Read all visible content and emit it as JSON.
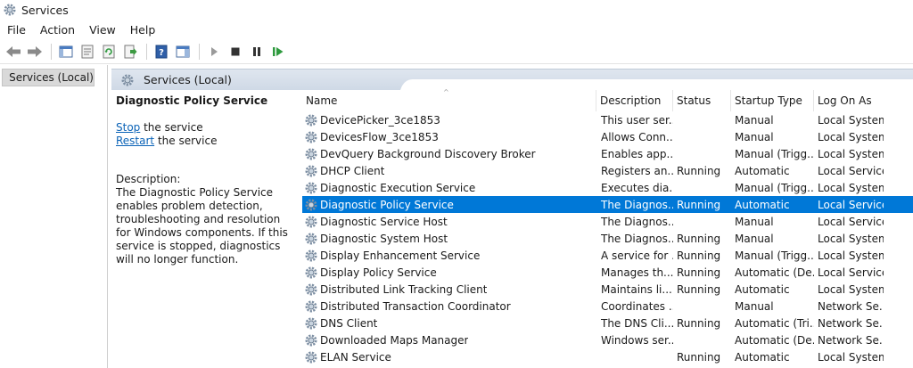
{
  "window": {
    "title": "Services"
  },
  "menu": [
    "File",
    "Action",
    "View",
    "Help"
  ],
  "toolbar": {
    "icons": [
      "back-arrow-icon",
      "forward-arrow-icon",
      "console-tree-icon",
      "properties-icon",
      "refresh-icon",
      "export-list-icon",
      "help-icon",
      "show-hide-action-pane-icon",
      "start-service-icon",
      "stop-service-icon",
      "pause-service-icon",
      "restart-service-icon"
    ]
  },
  "tree": {
    "label": "Services (Local)"
  },
  "main": {
    "header": "Services (Local)"
  },
  "detail": {
    "title": "Diagnostic Policy Service",
    "stop_link": "Stop",
    "stop_rest": " the service",
    "restart_link": "Restart",
    "restart_rest": " the service",
    "desc_label": "Description:",
    "desc_text": "The Diagnostic Policy Service enables problem detection, troubleshooting and resolution for Windows components.  If this service is stopped, diagnostics will no longer function."
  },
  "columns": [
    "Name",
    "Description",
    "Status",
    "Startup Type",
    "Log On As"
  ],
  "rows": [
    {
      "name": "DevicePicker_3ce1853",
      "desc": "This user ser...",
      "status": "",
      "startup": "Manual",
      "logon": "Local System"
    },
    {
      "name": "DevicesFlow_3ce1853",
      "desc": "Allows Conn...",
      "status": "",
      "startup": "Manual",
      "logon": "Local System"
    },
    {
      "name": "DevQuery Background Discovery Broker",
      "desc": "Enables app...",
      "status": "",
      "startup": "Manual (Trigg...",
      "logon": "Local System"
    },
    {
      "name": "DHCP Client",
      "desc": "Registers an...",
      "status": "Running",
      "startup": "Automatic",
      "logon": "Local Service"
    },
    {
      "name": "Diagnostic Execution Service",
      "desc": "Executes dia...",
      "status": "",
      "startup": "Manual (Trigg...",
      "logon": "Local System"
    },
    {
      "name": "Diagnostic Policy Service",
      "desc": "The Diagnos...",
      "status": "Running",
      "startup": "Automatic",
      "logon": "Local Service",
      "selected": true
    },
    {
      "name": "Diagnostic Service Host",
      "desc": "The Diagnos...",
      "status": "",
      "startup": "Manual",
      "logon": "Local Service"
    },
    {
      "name": "Diagnostic System Host",
      "desc": "The Diagnos...",
      "status": "Running",
      "startup": "Manual",
      "logon": "Local System"
    },
    {
      "name": "Display Enhancement Service",
      "desc": "A service for ...",
      "status": "Running",
      "startup": "Manual (Trigg...",
      "logon": "Local System"
    },
    {
      "name": "Display Policy Service",
      "desc": "Manages th...",
      "status": "Running",
      "startup": "Automatic (De...",
      "logon": "Local Service"
    },
    {
      "name": "Distributed Link Tracking Client",
      "desc": "Maintains li...",
      "status": "Running",
      "startup": "Automatic",
      "logon": "Local System"
    },
    {
      "name": "Distributed Transaction Coordinator",
      "desc": "Coordinates ...",
      "status": "",
      "startup": "Manual",
      "logon": "Network Se..."
    },
    {
      "name": "DNS Client",
      "desc": "The DNS Cli...",
      "status": "Running",
      "startup": "Automatic (Tri...",
      "logon": "Network Se..."
    },
    {
      "name": "Downloaded Maps Manager",
      "desc": "Windows ser...",
      "status": "",
      "startup": "Automatic (De...",
      "logon": "Network Se..."
    },
    {
      "name": "ELAN Service",
      "desc": "",
      "status": "Running",
      "startup": "Automatic",
      "logon": "Local System"
    }
  ],
  "colors": {
    "selection": "#0078d7",
    "link": "#0b63b7",
    "header_gradient_top": "#dfe6ef"
  }
}
